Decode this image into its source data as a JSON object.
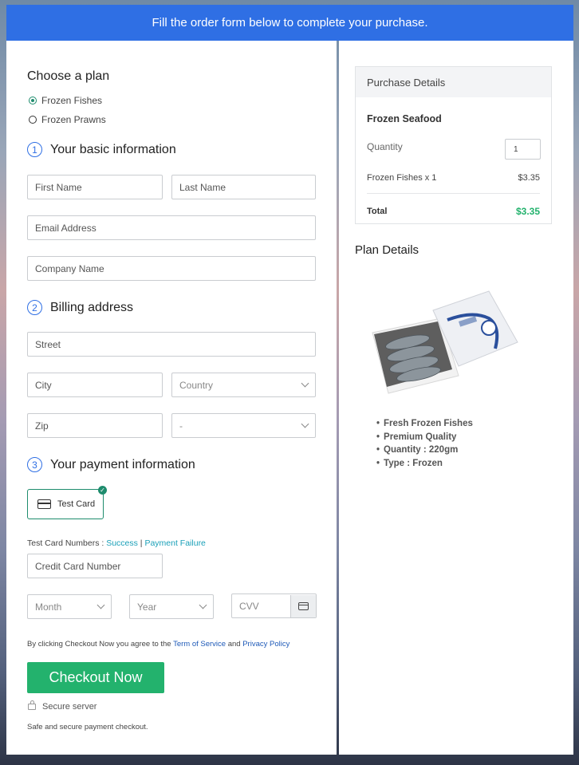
{
  "banner": "Fill the order form below to complete your purchase.",
  "plan": {
    "title": "Choose a plan",
    "options": [
      {
        "label": "Frozen Fishes",
        "selected": true
      },
      {
        "label": "Frozen Prawns",
        "selected": false
      }
    ]
  },
  "basic": {
    "num": "1",
    "title": "Your basic information",
    "first_name": "First Name",
    "last_name": "Last Name",
    "email": "Email Address",
    "company": "Company Name"
  },
  "billing": {
    "num": "2",
    "title": "Billing address",
    "street": "Street",
    "city": "City",
    "country": "Country",
    "zip": "Zip",
    "state": "-"
  },
  "payment": {
    "num": "3",
    "title": "Your payment information",
    "card_label": "Test Card",
    "test_numbers": "Test Card Numbers : ",
    "success": "Success",
    "sep": " | ",
    "failure": "Payment Failure",
    "card_number": "Credit Card Number",
    "month": "Month",
    "year": "Year",
    "cvv": "CVV"
  },
  "terms": {
    "prefix": "By clicking Checkout Now you agree to the ",
    "tos": "Term of Service",
    "and": " and ",
    "privacy": "Privacy Policy"
  },
  "checkout_label": "Checkout Now",
  "secure": "Secure server",
  "safe": "Safe and secure payment checkout.",
  "purchase": {
    "title": "Purchase Details",
    "product": "Frozen Seafood",
    "quantity_label": "Quantity",
    "quantity": "1",
    "line_item": "Frozen Fishes x 1",
    "line_price": "$3.35",
    "total_label": "Total",
    "total": "$3.35"
  },
  "plan_details": {
    "title": "Plan Details",
    "features": [
      "Fresh Frozen Fishes",
      "Premium Quality",
      "Quantity : 220gm",
      "Type : Frozen"
    ]
  },
  "colors": {
    "primary": "#2f6fe4",
    "accent": "#1e8c6d",
    "checkout": "#23b26d",
    "total": "#23b26d"
  }
}
